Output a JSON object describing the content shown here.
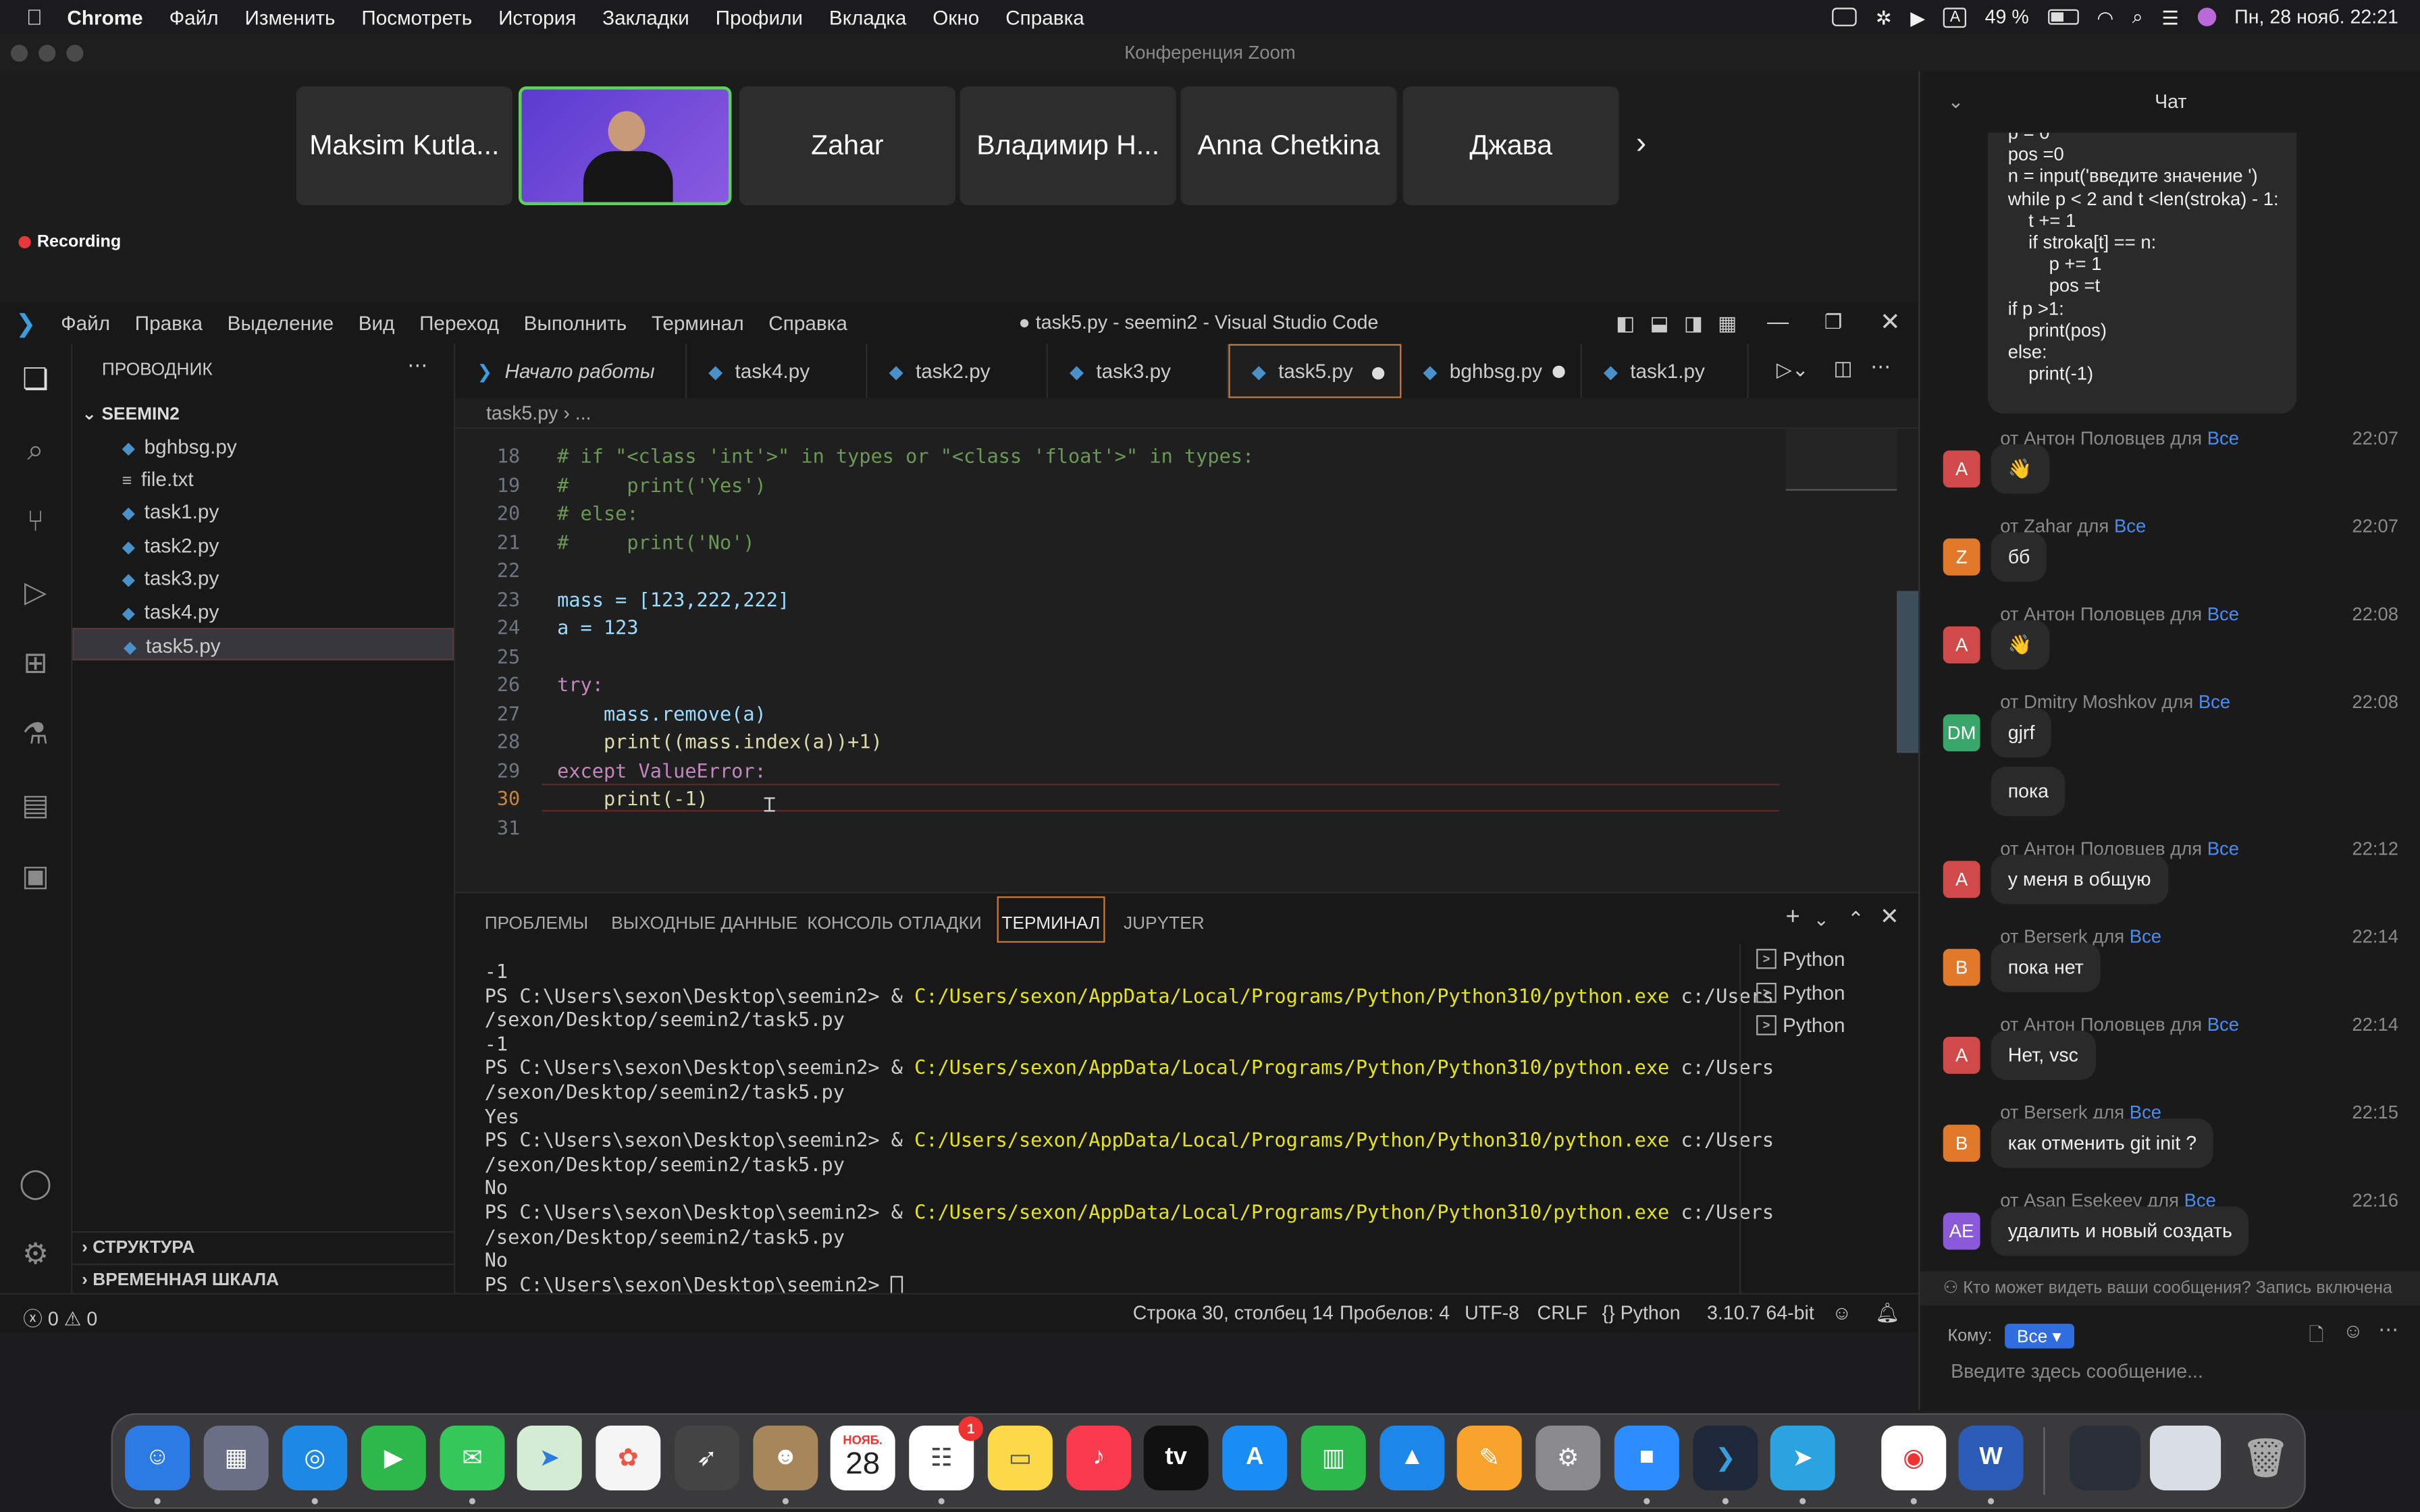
{
  "menubar": {
    "app": "Chrome",
    "items": [
      "Файл",
      "Изменить",
      "Посмотреть",
      "История",
      "Закладки",
      "Профили",
      "Вкладка",
      "Окно",
      "Справка"
    ],
    "battery": "49 %",
    "datetime": "Пн, 28 нояб.  22:21"
  },
  "zoom": {
    "title": "Конференция Zoom",
    "recording": "Recording",
    "participants": [
      "Maksim Kutla...",
      "",
      "Zahar",
      "Владимир Н...",
      "Anna Chetkina",
      "Джава"
    ],
    "next_icon": "chevron-right-icon"
  },
  "vscode": {
    "menu": [
      "Файл",
      "Правка",
      "Выделение",
      "Вид",
      "Переход",
      "Выполнить",
      "Терминал",
      "Справка"
    ],
    "title": "● task5.py - seemin2 - Visual Studio Code",
    "explorer_title": "ПРОВОДНИК",
    "folder": "SEEMIN2",
    "files": [
      "bghbsg.py",
      "file.txt",
      "task1.py",
      "task2.py",
      "task3.py",
      "task4.py",
      "task5.py"
    ],
    "outline": "СТРУКТУРА",
    "timeline": "ВРЕМЕННАЯ ШКАЛА",
    "tabs": [
      "Начало работы",
      "task4.py",
      "task2.py",
      "task3.py",
      "task5.py",
      "bghbsg.py",
      "task1.py"
    ],
    "breadcrumb": "task5.py › ...",
    "code_lines": [
      {
        "n": "18",
        "t": "# if \"<class 'int'>\" in types or \"<class 'float'>\" in types:"
      },
      {
        "n": "19",
        "t": "#     print('Yes')"
      },
      {
        "n": "20",
        "t": "# else:"
      },
      {
        "n": "21",
        "t": "#     print('No')"
      },
      {
        "n": "22",
        "t": ""
      },
      {
        "n": "23",
        "t": "mass = [123,222,222]"
      },
      {
        "n": "24",
        "t": "a = 123"
      },
      {
        "n": "25",
        "t": ""
      },
      {
        "n": "26",
        "t": "try:"
      },
      {
        "n": "27",
        "t": "    mass.remove(a)"
      },
      {
        "n": "28",
        "t": "    print((mass.index(a))+1)"
      },
      {
        "n": "29",
        "t": "except ValueError:"
      },
      {
        "n": "30",
        "t": "    print(-1)"
      },
      {
        "n": "31",
        "t": ""
      }
    ],
    "panel_tabs": [
      "ПРОБЛЕМЫ",
      "ВЫХОДНЫЕ ДАННЫЕ",
      "КОНСОЛЬ ОТЛАДКИ",
      "ТЕРМИНАЛ",
      "JUPYTER"
    ],
    "terminal": {
      "prompt": "PS C:\\Users\\sexon\\Desktop\\seemin2> & ",
      "exe": "C:/Users/sexon/AppData/Local/Programs/Python/Python310/python.exe",
      "arg1": " c:/Users",
      "arg2": "/sexon/Desktop/seemin2/task5.py",
      "outputs": [
        "-1",
        "-1",
        "Yes",
        "No",
        "No"
      ],
      "last_prompt": "PS C:\\Users\\sexon\\Desktop\\seemin2> "
    },
    "shells": [
      "Python",
      "Python",
      "Python"
    ],
    "status": {
      "errors": "0",
      "warnings": "0",
      "position": "Строка 30, столбец 14",
      "spaces": "Пробелов: 4",
      "encoding": "UTF-8",
      "eol": "CRLF",
      "lang": "Python",
      "version": "3.10.7 64-bit"
    }
  },
  "chat": {
    "title": "Чат",
    "code_bubble": [
      "p = 0",
      "pos =0",
      "",
      "n = input('введите значение ')",
      "while p < 2 and t <len(stroka) - 1:",
      "    t += 1",
      "    if stroka[t] == n:",
      "        p += 1",
      "        pos =t",
      "if p >1:",
      "    print(pos)",
      "else:",
      "    print(-1)"
    ],
    "for_label": "для",
    "to_label": "Все",
    "messages": [
      {
        "from": "от Антон Половцев",
        "time": "22:07",
        "text": "👋",
        "av": "A",
        "color": "#d04a4a"
      },
      {
        "from": "от Zahar",
        "time": "22:07",
        "text": "бб",
        "av": "Z",
        "color": "#e07a2a"
      },
      {
        "from": "от Антон Половцев",
        "time": "22:08",
        "text": "👋",
        "av": "A",
        "color": "#d04a4a"
      },
      {
        "from": "от Dmitry Moshkov",
        "time": "22:08",
        "text": "gjrf",
        "av": "DM",
        "color": "#3aa76a"
      },
      {
        "from": "",
        "time": "",
        "text": "пока",
        "av": "",
        "color": ""
      },
      {
        "from": "от Антон Половцев",
        "time": "22:12",
        "text": "у меня в общую",
        "av": "A",
        "color": "#d04a4a"
      },
      {
        "from": "от Berserk",
        "time": "22:14",
        "text": "пока нет",
        "av": "B",
        "color": "#e07a2a"
      },
      {
        "from": "от Антон Половцев",
        "time": "22:14",
        "text": "Нет, vsc",
        "av": "A",
        "color": "#d04a4a"
      },
      {
        "from": "от Berserk",
        "time": "22:15",
        "text": "как отменить git init ?",
        "av": "B",
        "color": "#e07a2a"
      },
      {
        "from": "от Asan Esekeev",
        "time": "22:16",
        "text": "удалить и новый создать",
        "av": "AE",
        "color": "#8a5ad8"
      }
    ],
    "visibility": "Кто может видеть ваши сообщения? Запись включена",
    "to_prefix": "Кому:",
    "to_value": "Все",
    "placeholder": "Введите здесь сообщение..."
  },
  "dock": {
    "calendar_month": "НОЯБ.",
    "calendar_day": "28",
    "reminders_badge": "1"
  }
}
